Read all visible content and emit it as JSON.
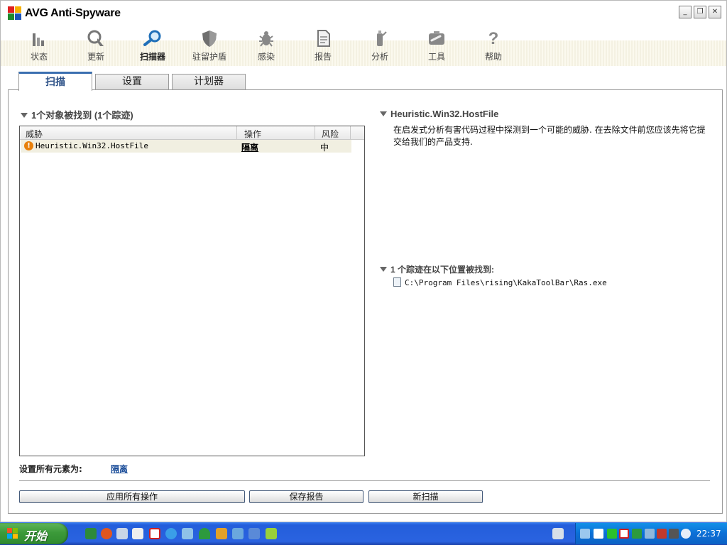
{
  "app": {
    "title": "AVG Anti-Spyware"
  },
  "window_controls": {
    "minimize": "_",
    "restore": "❐",
    "close": "✕"
  },
  "toolbar": {
    "items": [
      {
        "label": "状态",
        "icon": "bar-chart-icon"
      },
      {
        "label": "更新",
        "icon": "update-icon"
      },
      {
        "label": "扫描器",
        "icon": "magnifier-icon",
        "active": true
      },
      {
        "label": "驻留护盾",
        "icon": "shield-icon"
      },
      {
        "label": "感染",
        "icon": "bug-icon"
      },
      {
        "label": "报告",
        "icon": "report-icon"
      },
      {
        "label": "分析",
        "icon": "analysis-icon"
      },
      {
        "label": "工具",
        "icon": "tools-icon"
      },
      {
        "label": "帮助",
        "icon": "help-icon"
      }
    ]
  },
  "tabs": [
    {
      "label": "扫描",
      "active": true
    },
    {
      "label": "设置"
    },
    {
      "label": "计划器"
    }
  ],
  "scan": {
    "found_title": "1个对象被找到 (1个踪迹)",
    "columns": {
      "threat": "威胁",
      "action": "操作",
      "risk": "风险"
    },
    "rows": [
      {
        "threat": "Heuristic.Win32.HostFile",
        "action": "隔离",
        "risk": "中"
      }
    ],
    "set_all_label": "设置所有元素为:",
    "set_all_value": "隔离"
  },
  "detail": {
    "threat_name": "Heuristic.Win32.HostFile",
    "description": "在启发式分析有害代码过程中探测到一个可能的威胁. 在去除文件前您应该先将它提交给我们的产品支持.",
    "traces_title": "1 个踪迹在以下位置被找到:",
    "trace_path": "C:\\Program Files\\rising\\KakaToolBar\\Ras.exe"
  },
  "buttons": {
    "apply_all": "应用所有操作",
    "save_report": "保存报告",
    "new_scan": "新扫描"
  },
  "taskbar": {
    "start_label": "开始",
    "clock": "22:37"
  },
  "colors": {
    "accent": "#3a6fb0",
    "link": "#1d4f9a",
    "taskbar": "#245edb",
    "start": "#3c9a3a"
  }
}
